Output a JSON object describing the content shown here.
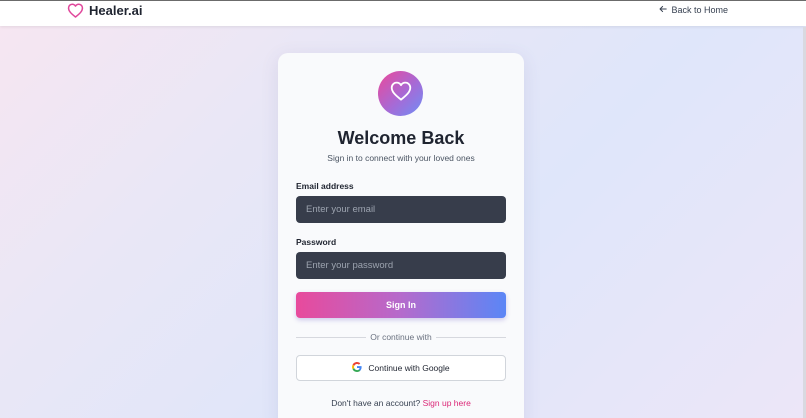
{
  "header": {
    "brand_name": "Healer.ai",
    "back_link": "Back to Home"
  },
  "login": {
    "title": "Welcome Back",
    "subtitle": "Sign in to connect with your loved ones",
    "email_label": "Email address",
    "email_placeholder": "Enter your email",
    "email_value": "",
    "password_label": "Password",
    "password_placeholder": "Enter your password",
    "password_value": "",
    "signin_label": "Sign In",
    "divider_text": "Or continue with",
    "google_label": "Continue with Google",
    "signup_prompt": "Don't have an account?",
    "signup_link": "Sign up here"
  },
  "icons": {
    "brand": "heart-outline-icon",
    "back": "arrow-left-icon",
    "logo": "heart-outline-icon",
    "google": "google-g-icon"
  },
  "colors": {
    "accent_pink": "#ec4899",
    "accent_blue": "#5b86f6",
    "input_bg": "#373d4b",
    "link": "#db2777"
  }
}
